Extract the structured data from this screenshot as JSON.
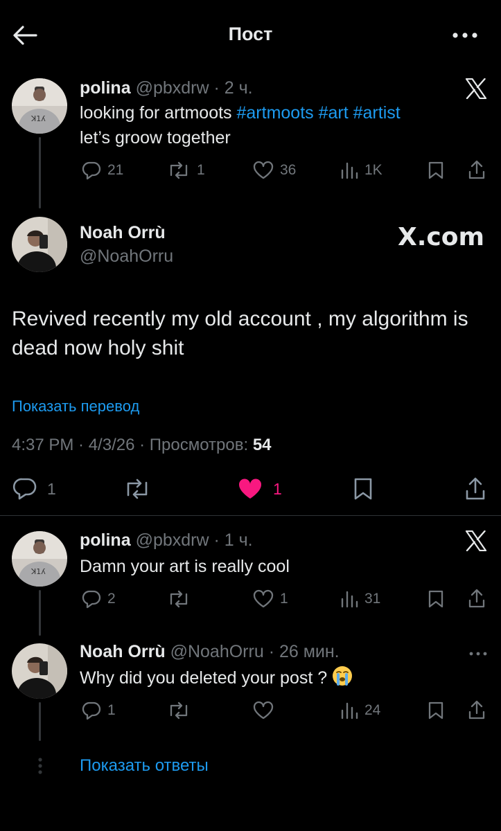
{
  "header": {
    "title": "Пост"
  },
  "reply1": {
    "name": "polina",
    "handle": "@pbxdrw",
    "time": "· 2 ч.",
    "text_plain": "looking for artmoots ",
    "hashtags": "#artmoots #art #artist",
    "text_line2": "let’s groow together",
    "replies": "21",
    "reposts": "1",
    "likes": "36",
    "views": "1K"
  },
  "main": {
    "name": "Noah Orrù",
    "handle": "@NoahOrru",
    "watermark": "X.com",
    "text": "Revived recently my old account , my algorithm is dead now holy shit",
    "translate": "Показать перевод",
    "meta": "4:37 PM · 4/3/26 · Просмотров: ",
    "views": "54",
    "replies": "1",
    "likes": "1",
    "like_color": "#f91880"
  },
  "reply2": {
    "name": "polina",
    "handle": "@pbxdrw",
    "time": "· 1 ч.",
    "text": "Damn your art is really cool",
    "replies": "2",
    "likes": "1",
    "views": "31"
  },
  "reply3": {
    "name": "Noah Orrù",
    "handle": "@NoahOrru",
    "time": "· 26 мин.",
    "text": "Why did you deleted your post ? ",
    "emoji": "😭",
    "replies": "1",
    "views": "24"
  },
  "show_replies": "Показать ответы",
  "colors": {
    "accent": "#1d9bf0",
    "like": "#f91880",
    "muted": "#71767b"
  }
}
